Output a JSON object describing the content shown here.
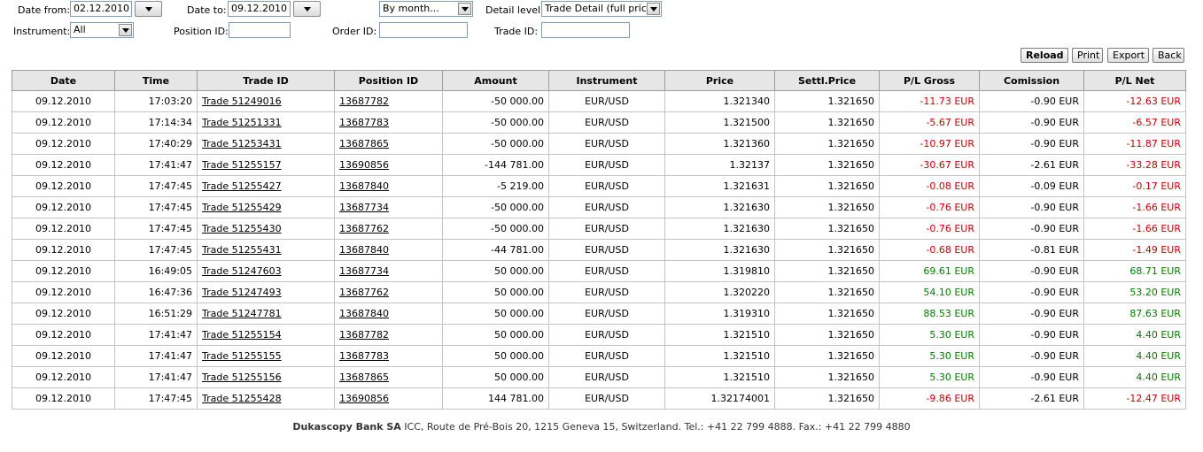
{
  "filters": {
    "date_from_label": "Date from:",
    "date_from_value": "02.12.2010",
    "date_to_label": "Date to:",
    "date_to_value": "09.12.2010",
    "period_value": "By month...",
    "detail_level_label": "Detail level:",
    "detail_level_value": "Trade Detail (full price)",
    "instrument_label": "Instrument:",
    "instrument_value": "All",
    "position_id_label": "Position ID:",
    "position_id_value": "",
    "order_id_label": "Order ID:",
    "order_id_value": "",
    "trade_id_label": "Trade ID:",
    "trade_id_value": ""
  },
  "toolbar": {
    "reload_label": "Reload",
    "print_label": "Print",
    "export_label": "Export",
    "back_label": "Back"
  },
  "table": {
    "headers": [
      "Date",
      "Time",
      "Trade ID",
      "Position ID",
      "Amount",
      "Instrument",
      "Price",
      "Settl.Price",
      "P/L Gross",
      "Comission",
      "P/L Net"
    ],
    "rows": [
      [
        "09.12.2010",
        "17:03:20",
        "Trade 51249016",
        "13687782",
        "-50 000.00",
        "EUR/USD",
        "1.321340",
        "1.321650",
        "-11.73 EUR",
        "-0.90 EUR",
        "-12.63 EUR"
      ],
      [
        "09.12.2010",
        "17:14:34",
        "Trade 51251331",
        "13687783",
        "-50 000.00",
        "EUR/USD",
        "1.321500",
        "1.321650",
        "-5.67 EUR",
        "-0.90 EUR",
        "-6.57 EUR"
      ],
      [
        "09.12.2010",
        "17:40:29",
        "Trade 51253431",
        "13687865",
        "-50 000.00",
        "EUR/USD",
        "1.321360",
        "1.321650",
        "-10.97 EUR",
        "-0.90 EUR",
        "-11.87 EUR"
      ],
      [
        "09.12.2010",
        "17:41:47",
        "Trade 51255157",
        "13690856",
        "-144 781.00",
        "EUR/USD",
        "1.32137",
        "1.321650",
        "-30.67 EUR",
        "-2.61 EUR",
        "-33.28 EUR"
      ],
      [
        "09.12.2010",
        "17:47:45",
        "Trade 51255427",
        "13687840",
        "-5 219.00",
        "EUR/USD",
        "1.321631",
        "1.321650",
        "-0.08 EUR",
        "-0.09 EUR",
        "-0.17 EUR"
      ],
      [
        "09.12.2010",
        "17:47:45",
        "Trade 51255429",
        "13687734",
        "-50 000.00",
        "EUR/USD",
        "1.321630",
        "1.321650",
        "-0.76 EUR",
        "-0.90 EUR",
        "-1.66 EUR"
      ],
      [
        "09.12.2010",
        "17:47:45",
        "Trade 51255430",
        "13687762",
        "-50 000.00",
        "EUR/USD",
        "1.321630",
        "1.321650",
        "-0.76 EUR",
        "-0.90 EUR",
        "-1.66 EUR"
      ],
      [
        "09.12.2010",
        "17:47:45",
        "Trade 51255431",
        "13687840",
        "-44 781.00",
        "EUR/USD",
        "1.321630",
        "1.321650",
        "-0.68 EUR",
        "-0.81 EUR",
        "-1.49 EUR"
      ],
      [
        "09.12.2010",
        "16:49:05",
        "Trade 51247603",
        "13687734",
        "50 000.00",
        "EUR/USD",
        "1.319810",
        "1.321650",
        "69.61 EUR",
        "-0.90 EUR",
        "68.71 EUR"
      ],
      [
        "09.12.2010",
        "16:47:36",
        "Trade 51247493",
        "13687762",
        "50 000.00",
        "EUR/USD",
        "1.320220",
        "1.321650",
        "54.10 EUR",
        "-0.90 EUR",
        "53.20 EUR"
      ],
      [
        "09.12.2010",
        "16:51:29",
        "Trade 51247781",
        "13687840",
        "50 000.00",
        "EUR/USD",
        "1.319310",
        "1.321650",
        "88.53 EUR",
        "-0.90 EUR",
        "87.63 EUR"
      ],
      [
        "09.12.2010",
        "17:41:47",
        "Trade 51255154",
        "13687782",
        "50 000.00",
        "EUR/USD",
        "1.321510",
        "1.321650",
        "5.30 EUR",
        "-0.90 EUR",
        "4.40 EUR"
      ],
      [
        "09.12.2010",
        "17:41:47",
        "Trade 51255155",
        "13687783",
        "50 000.00",
        "EUR/USD",
        "1.321510",
        "1.321650",
        "5.30 EUR",
        "-0.90 EUR",
        "4.40 EUR"
      ],
      [
        "09.12.2010",
        "17:41:47",
        "Trade 51255156",
        "13687865",
        "50 000.00",
        "EUR/USD",
        "1.321510",
        "1.321650",
        "5.30 EUR",
        "-0.90 EUR",
        "4.40 EUR"
      ],
      [
        "09.12.2010",
        "17:47:45",
        "Trade 51255428",
        "13690856",
        "144 781.00",
        "EUR/USD",
        "1.32174001",
        "1.321650",
        "-9.86 EUR",
        "-2.61 EUR",
        "-12.47 EUR"
      ]
    ]
  },
  "footer": {
    "company": "Dukascopy Bank SA",
    "address": " ICC, Route de Pré-Bois 20, 1215 Geneva 15, Switzerland. Tel.: +41 22 799 4888. Fax.: +41 22 799 4880"
  },
  "colors": {
    "negative": "#cc0000",
    "positive": "#008000",
    "header_bg": "#e6e6e6"
  }
}
